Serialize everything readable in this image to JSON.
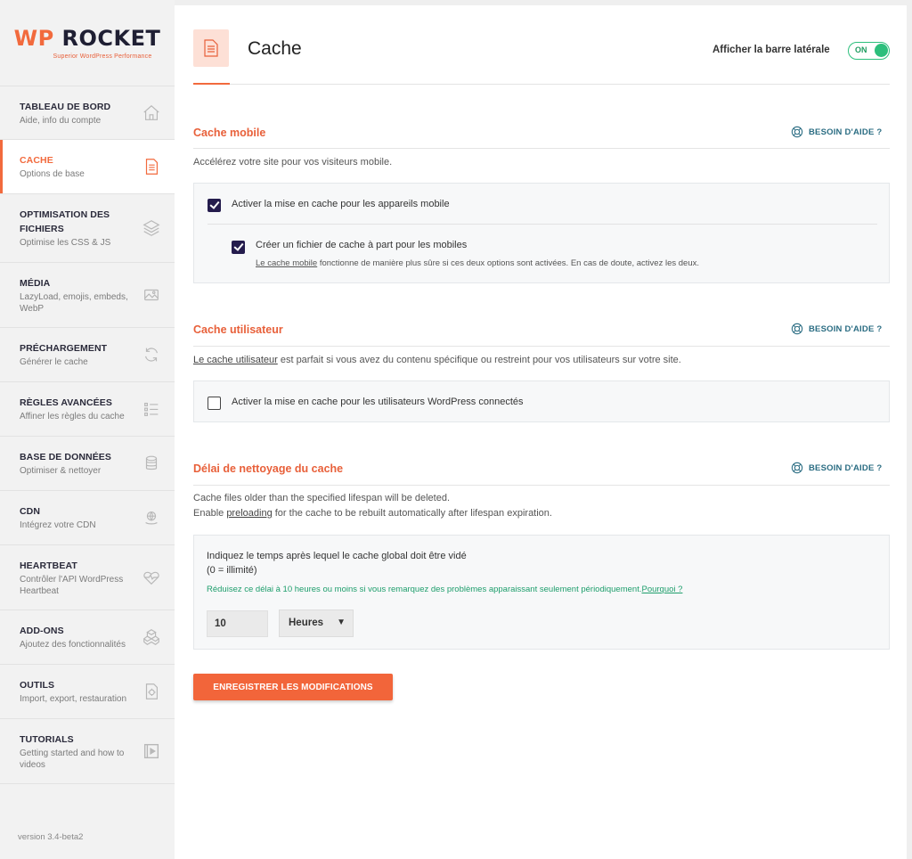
{
  "brand": {
    "logo_wp": "WP",
    "logo_rest": " ROCKET",
    "tagline": "Superior WordPress Performance"
  },
  "sidebar": {
    "items": [
      {
        "title": "TABLEAU DE BORD",
        "desc": "Aide, info du compte",
        "icon": "home-icon"
      },
      {
        "title": "CACHE",
        "desc": "Options de base",
        "icon": "document-icon",
        "active": true
      },
      {
        "title": "OPTIMISATION DES FICHIERS",
        "desc": "Optimise les CSS & JS",
        "icon": "layers-icon"
      },
      {
        "title": "MÉDIA",
        "desc": "LazyLoad, emojis, embeds, WebP",
        "icon": "image-icon"
      },
      {
        "title": "PRÉCHARGEMENT",
        "desc": "Générer le cache",
        "icon": "refresh-icon"
      },
      {
        "title": "RÈGLES AVANCÉES",
        "desc": "Affiner les règles du cache",
        "icon": "list-icon"
      },
      {
        "title": "BASE DE DONNÉES",
        "desc": "Optimiser & nettoyer",
        "icon": "database-icon"
      },
      {
        "title": "CDN",
        "desc": "Intégrez votre CDN",
        "icon": "globe-icon"
      },
      {
        "title": "HEARTBEAT",
        "desc": "Contrôler l'API WordPress Heartbeat",
        "icon": "heart-icon"
      },
      {
        "title": "ADD-ONS",
        "desc": "Ajoutez des fonctionnalités",
        "icon": "addons-icon"
      },
      {
        "title": "OUTILS",
        "desc": "Import, export, restauration",
        "icon": "tools-icon"
      },
      {
        "title": "TUTORIALS",
        "desc": "Getting started and how to videos",
        "icon": "video-icon"
      }
    ],
    "version": "version 3.4-beta2"
  },
  "header": {
    "title": "Cache",
    "sidebar_toggle_label": "Afficher la barre latérale",
    "toggle_state": "ON"
  },
  "help_label": "BESOIN D'AIDE ?",
  "sections": {
    "mobile": {
      "title": "Cache mobile",
      "desc": "Accélérez votre site pour vos visiteurs mobile.",
      "option1": "Activer la mise en cache pour les appareils mobile",
      "option1_checked": true,
      "option2": "Créer un fichier de cache à part pour les mobiles",
      "option2_checked": true,
      "note_link": "Le cache mobile",
      "note_rest": " fonctionne de manière plus sûre si ces deux options sont activées. En cas de doute, activez les deux."
    },
    "user": {
      "title": "Cache utilisateur",
      "desc_link": "Le cache utilisateur",
      "desc_rest": " est parfait si vous avez du contenu spécifique ou restreint pour vos utilisateurs sur votre site.",
      "option1": "Activer la mise en cache pour les utilisateurs WordPress connectés",
      "option1_checked": false
    },
    "lifespan": {
      "title": "Délai de nettoyage du cache",
      "desc_line1": "Cache files older than the specified lifespan will be deleted.",
      "desc_line2_pre": "Enable ",
      "desc_line2_link": "preloading",
      "desc_line2_post": " for the cache to be rebuilt automatically after lifespan expiration.",
      "field_label_1": "Indiquez le temps après lequel le cache global doit être vidé",
      "field_label_2": "(0 = illimité)",
      "hint": "Réduisez ce délai à 10 heures ou moins si vous remarquez des problèmes apparaissant seulement périodiquement.",
      "hint_link": "Pourquoi ?",
      "value": "10",
      "unit": "Heures"
    }
  },
  "save_button": "ENREGISTRER LES MODIFICATIONS",
  "colors": {
    "accent": "#f26a3d",
    "toggle_green": "#2cbf7c",
    "checkbox": "#241c4d",
    "help_blue": "#2b6d83"
  }
}
